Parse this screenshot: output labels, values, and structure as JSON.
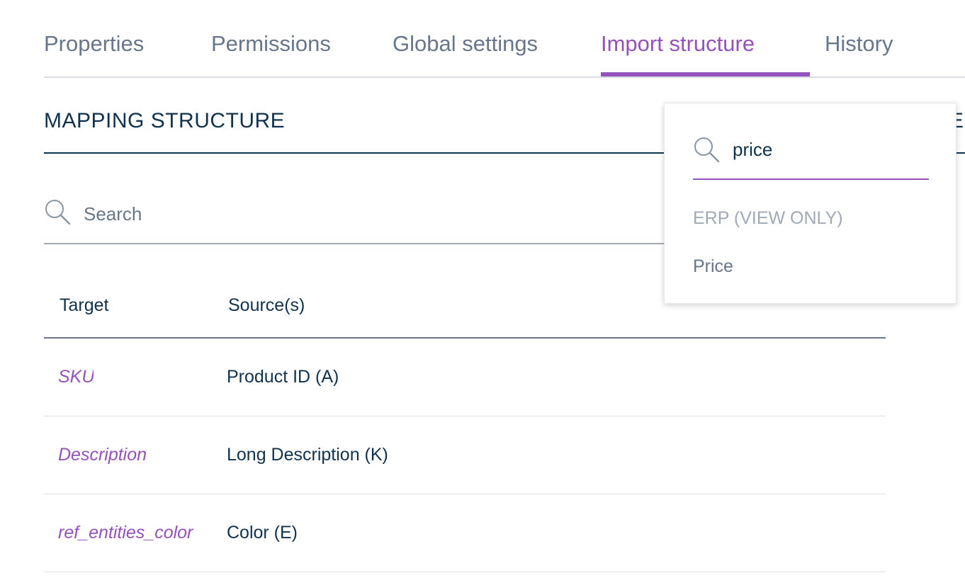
{
  "tabs": [
    {
      "label": "Properties",
      "active": false
    },
    {
      "label": "Permissions",
      "active": false
    },
    {
      "label": "Global settings",
      "active": false
    },
    {
      "label": "Import structure",
      "active": true
    },
    {
      "label": "History",
      "active": false
    }
  ],
  "section": {
    "title": "MAPPING STRUCTURE",
    "right_letter": "E"
  },
  "search": {
    "placeholder": "Search",
    "value": "",
    "icon": "search-icon"
  },
  "table": {
    "headers": {
      "target": "Target",
      "source": "Source(s)"
    },
    "rows": [
      {
        "target": "SKU",
        "source": "Product ID (A)"
      },
      {
        "target": "Description",
        "source": "Long Description (K)"
      },
      {
        "target": "ref_entities_color",
        "source": "Color (E)"
      }
    ]
  },
  "dropdown": {
    "search_value": "price",
    "search_icon": "search-icon",
    "group_label": "ERP (VIEW ONLY)",
    "options": [
      "Price"
    ]
  },
  "colors": {
    "accent": "#9452ba",
    "text_dark": "#11324d",
    "text_muted": "#67768a",
    "text_light": "#a0a9b4"
  }
}
